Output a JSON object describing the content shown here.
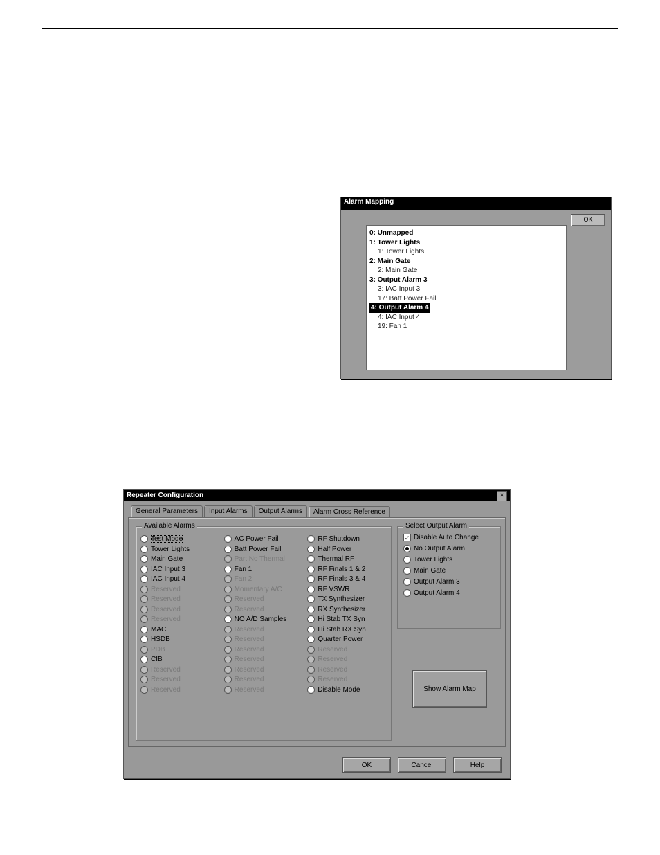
{
  "dialog1": {
    "title": "Alarm Mapping",
    "ok": "OK",
    "tree": {
      "n0": "0: Unmapped",
      "n1": "1: Tower Lights",
      "n1c1": "1: Tower Lights",
      "n2": "2: Main Gate",
      "n2c1": "2: Main Gate",
      "n3": "3: Output Alarm 3",
      "n3c1": "3: IAC Input 3",
      "n3c2": "17: Batt Power Fail",
      "n4": "4: Output Alarm 4",
      "n4c1": "4: IAC Input 4",
      "n4c2": "19: Fan 1"
    }
  },
  "dialog2": {
    "title": "Repeater Configuration",
    "close": "×",
    "tabs": {
      "t1": "General Parameters",
      "t2": "Input Alarms",
      "t3": "Output Alarms",
      "t4": "Alarm Cross Reference"
    },
    "available_legend": "Available Alarms",
    "select_legend": "Select Output Alarm",
    "col1": [
      {
        "label": "Test Mode",
        "disabled": false,
        "focus": true
      },
      {
        "label": "Tower Lights",
        "disabled": false
      },
      {
        "label": "Main Gate",
        "disabled": false
      },
      {
        "label": "IAC Input 3",
        "disabled": false
      },
      {
        "label": "IAC Input 4",
        "disabled": false
      },
      {
        "label": "Reserved",
        "disabled": true
      },
      {
        "label": "Reserved",
        "disabled": true
      },
      {
        "label": "Reserved",
        "disabled": true
      },
      {
        "label": "Reserved",
        "disabled": true
      },
      {
        "label": "MAC",
        "disabled": false
      },
      {
        "label": "HSDB",
        "disabled": false
      },
      {
        "label": "PDB",
        "disabled": true
      },
      {
        "label": "CIB",
        "disabled": false
      },
      {
        "label": "Reserved",
        "disabled": true
      },
      {
        "label": "Reserved",
        "disabled": true
      },
      {
        "label": "Reserved",
        "disabled": true
      }
    ],
    "col2": [
      {
        "label": "AC Power Fail",
        "disabled": false
      },
      {
        "label": "Batt Power Fail",
        "disabled": false
      },
      {
        "label": "Part No Thermal",
        "disabled": true
      },
      {
        "label": "Fan 1",
        "disabled": false
      },
      {
        "label": "Fan 2",
        "disabled": true
      },
      {
        "label": "Momentary A/C",
        "disabled": true
      },
      {
        "label": "Reserved",
        "disabled": true
      },
      {
        "label": "Reserved",
        "disabled": true
      },
      {
        "label": "NO A/D Samples",
        "disabled": false
      },
      {
        "label": "Reserved",
        "disabled": true
      },
      {
        "label": "Reserved",
        "disabled": true
      },
      {
        "label": "Reserved",
        "disabled": true
      },
      {
        "label": "Reserved",
        "disabled": true
      },
      {
        "label": "Reserved",
        "disabled": true
      },
      {
        "label": "Reserved",
        "disabled": true
      },
      {
        "label": "Reserved",
        "disabled": true
      }
    ],
    "col3": [
      {
        "label": "RF Shutdown",
        "disabled": false
      },
      {
        "label": "Half Power",
        "disabled": false
      },
      {
        "label": "Thermal RF",
        "disabled": false
      },
      {
        "label": "RF Finals 1 & 2",
        "disabled": false
      },
      {
        "label": "RF Finals 3 & 4",
        "disabled": false
      },
      {
        "label": "RF VSWR",
        "disabled": false
      },
      {
        "label": "TX Synthesizer",
        "disabled": false
      },
      {
        "label": "RX Synthesizer",
        "disabled": false
      },
      {
        "label": "Hi Stab TX Syn",
        "disabled": false
      },
      {
        "label": "Hi Stab RX Syn",
        "disabled": false
      },
      {
        "label": "Quarter Power",
        "disabled": false
      },
      {
        "label": "Reserved",
        "disabled": true
      },
      {
        "label": "Reserved",
        "disabled": true
      },
      {
        "label": "Reserved",
        "disabled": true
      },
      {
        "label": "Reserved",
        "disabled": true
      },
      {
        "label": "Disable Mode",
        "disabled": false
      }
    ],
    "selout": {
      "disable_auto": "Disable Auto Change",
      "r1": "No Output Alarm",
      "r2": "Tower Lights",
      "r3": "Main Gate",
      "r4": "Output Alarm 3",
      "r5": "Output Alarm 4"
    },
    "showmap": "Show Alarm Map",
    "buttons": {
      "ok": "OK",
      "cancel": "Cancel",
      "help": "Help"
    }
  }
}
